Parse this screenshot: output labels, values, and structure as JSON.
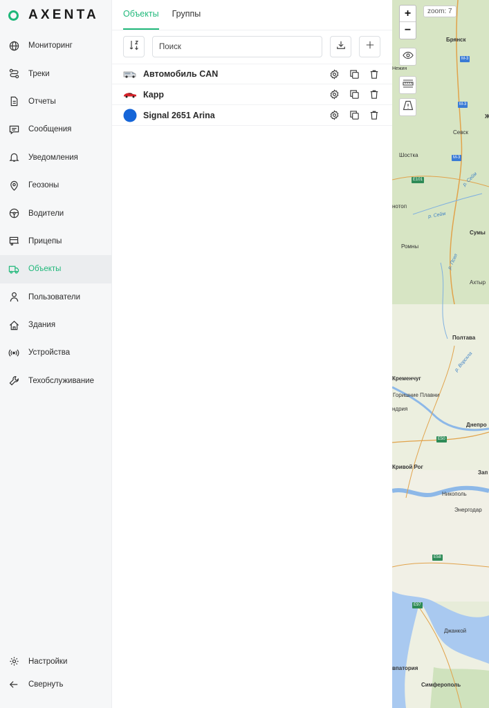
{
  "brand": {
    "name": "AXENTA",
    "accent": "#1fb87a"
  },
  "sidebar": {
    "items": [
      {
        "label": "Мониторинг",
        "icon": "globe-icon"
      },
      {
        "label": "Треки",
        "icon": "route-icon"
      },
      {
        "label": "Отчеты",
        "icon": "report-icon"
      },
      {
        "label": "Сообщения",
        "icon": "message-icon"
      },
      {
        "label": "Уведомления",
        "icon": "bell-icon"
      },
      {
        "label": "Геозоны",
        "icon": "location-pin-icon"
      },
      {
        "label": "Водители",
        "icon": "steering-wheel-icon"
      },
      {
        "label": "Прицепы",
        "icon": "trailer-icon"
      },
      {
        "label": "Объекты",
        "icon": "truck-icon",
        "active": true
      },
      {
        "label": "Пользователи",
        "icon": "user-icon"
      },
      {
        "label": "Здания",
        "icon": "home-icon"
      },
      {
        "label": "Устройства",
        "icon": "broadcast-icon"
      },
      {
        "label": "Техобслуживание",
        "icon": "wrench-icon"
      }
    ],
    "bottom": [
      {
        "label": "Настройки",
        "icon": "gear-icon"
      },
      {
        "label": "Свернуть",
        "icon": "arrow-left-icon"
      }
    ]
  },
  "tabs": [
    {
      "label": "Объекты",
      "active": true
    },
    {
      "label": "Группы",
      "active": false
    }
  ],
  "search": {
    "placeholder": "Поиск",
    "value": ""
  },
  "objects": [
    {
      "name": "Автомобиль CAN",
      "icon": "van-icon"
    },
    {
      "name": "Карр",
      "icon": "red-car-icon"
    },
    {
      "name": "Signal 2651 Arina",
      "icon": "blue-dot-icon",
      "color": "#1565d8"
    }
  ],
  "map": {
    "zoom_label": "zoom: 7",
    "zoom_in": "+",
    "zoom_out": "−",
    "labels": {
      "bryansk": "Брянск",
      "m3a": "М-3",
      "m3b": "М-3",
      "m3c": "М-3",
      "zh": "Ж",
      "sevsk": "Севск",
      "shostka": "Шостка",
      "e101": "E101",
      "seim1": "р. Сейм",
      "konotop": "нотоп",
      "seim2": "р. Сейм",
      "sumy": "Сумы",
      "romny": "Ромны",
      "psel": "р. Псел",
      "akhtyr": "Ахтыр",
      "poltava": "Полтава",
      "vorskla": "р. Ворскла",
      "kremenchug": "Кременчуг",
      "gorishnie": "Горишние Плавни",
      "andriya": "ндрия",
      "dnepr": "Днепро",
      "e50": "E50",
      "krivoy": "Кривой Рог",
      "zap": "Зап",
      "nikopol": "Никополь",
      "energodar": "Энергодар",
      "e58": "E58",
      "e97": "E97",
      "dzhankoi": "Джанкой",
      "evpatoria": "впатория",
      "simferopol": "Симферополь",
      "nezhin": "Нежин"
    }
  }
}
